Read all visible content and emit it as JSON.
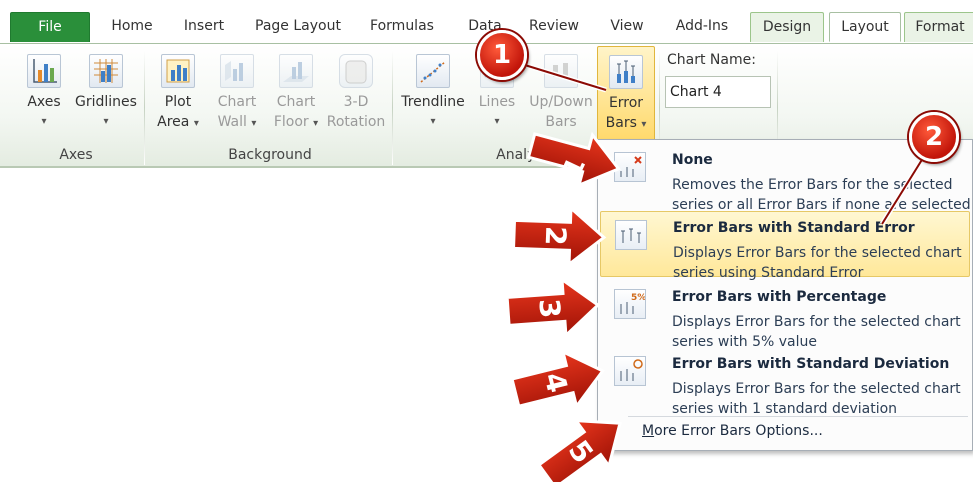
{
  "tabs": {
    "file": "File",
    "home": "Home",
    "insert": "Insert",
    "page_layout": "Page Layout",
    "formulas": "Formulas",
    "data": "Data",
    "review": "Review",
    "view": "View",
    "addins": "Add-Ins",
    "design": "Design",
    "layout": "Layout",
    "format": "Format"
  },
  "ribbon": {
    "axes": {
      "label": "Axes",
      "buttons": {
        "axes": "Axes",
        "gridlines": "Gridlines"
      }
    },
    "background": {
      "label": "Background",
      "buttons": {
        "plot_area_1": "Plot",
        "plot_area_2": "Area",
        "chart_wall_1": "Chart",
        "chart_wall_2": "Wall",
        "chart_floor_1": "Chart",
        "chart_floor_2": "Floor",
        "rotation_1": "3-D",
        "rotation_2": "Rotation"
      }
    },
    "analysis": {
      "label": "Analysis",
      "buttons": {
        "trendline": "Trendline",
        "lines": "Lines",
        "updown_1": "Up/Down",
        "updown_2": "Bars",
        "error_1": "Error",
        "error_2": "Bars"
      }
    },
    "chart_name": {
      "label": "Chart Name:",
      "value": "Chart 4"
    }
  },
  "dropdown": {
    "items": [
      {
        "title": "None",
        "desc": "Removes the Error Bars for the selected series or all Error Bars if none are selected"
      },
      {
        "title": "Error Bars with Standard Error",
        "desc": "Displays Error Bars for the selected chart series using Standard Error"
      },
      {
        "title": "Error Bars with Percentage",
        "desc": "Displays Error Bars for the selected chart series with 5% value"
      },
      {
        "title": "Error Bars with Standard Deviation",
        "desc": "Displays Error Bars for the selected chart series with 1 standard deviation"
      }
    ],
    "more_prefix": "M",
    "more_rest": "ore Error Bars Options...",
    "percent_icon_text": "5%"
  },
  "callouts": {
    "c1": "1",
    "c2": "2"
  },
  "arrows": {
    "a1": "1",
    "a2": "2",
    "a3": "3",
    "a4": "4",
    "a5": "5"
  },
  "colors": {
    "file_tab": "#2a8f3a",
    "callout": "#d4200f",
    "highlight": "#ffe89a"
  }
}
